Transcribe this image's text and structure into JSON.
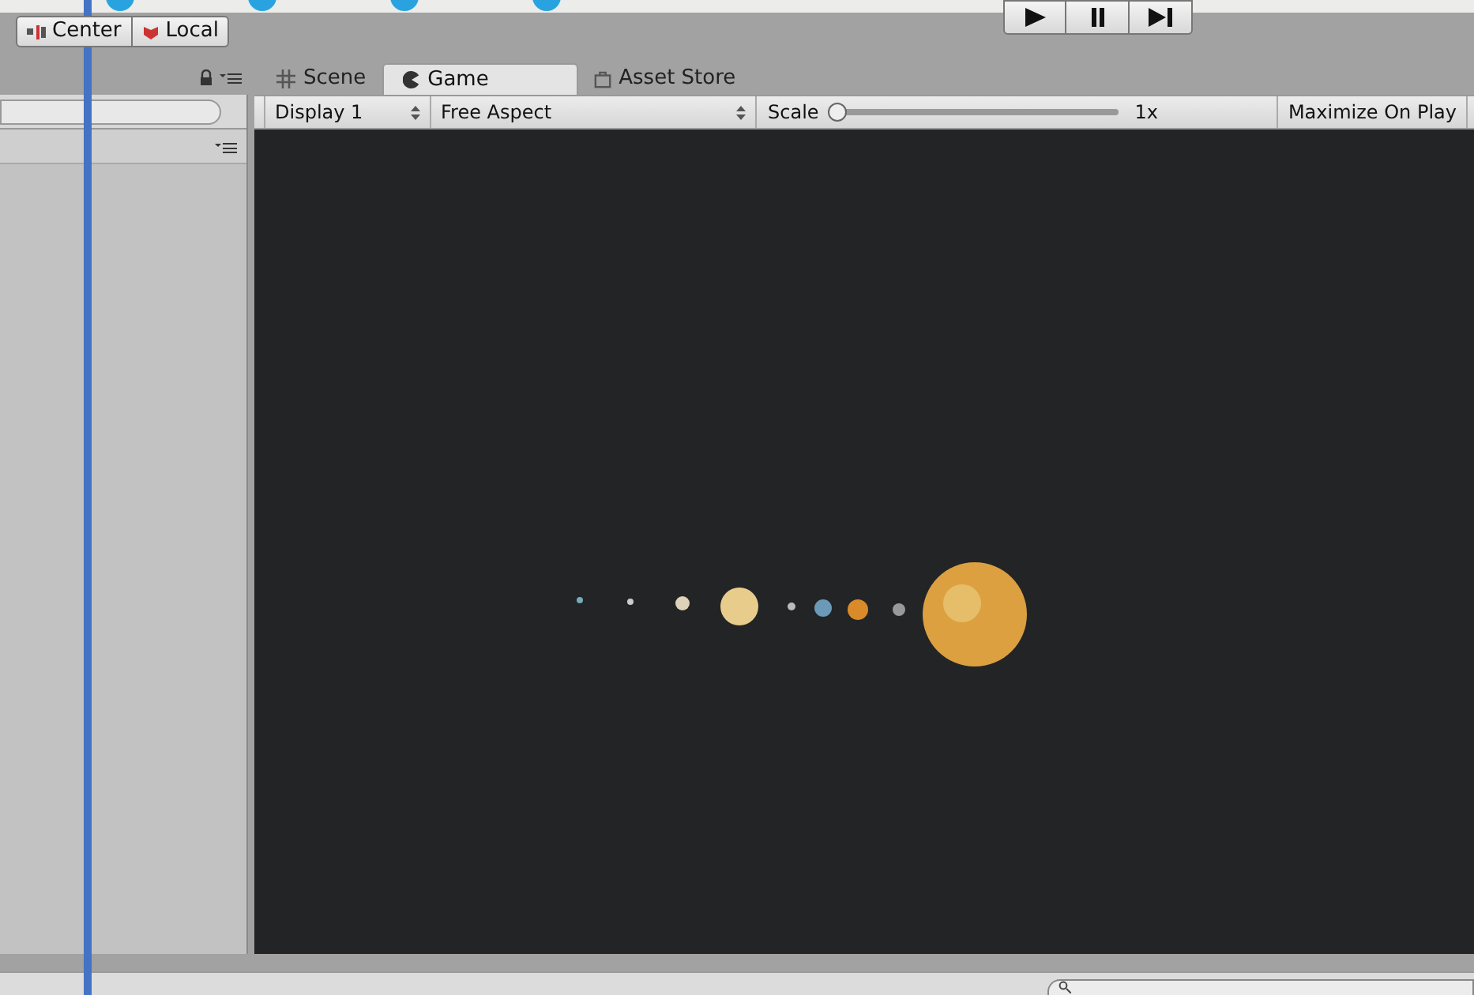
{
  "pivot_buttons": [
    {
      "label": "Center",
      "kind": "center"
    },
    {
      "label": "Local",
      "kind": "local"
    }
  ],
  "play_controls": [
    {
      "kind": "play",
      "selected": false
    },
    {
      "kind": "pause",
      "selected": false
    },
    {
      "kind": "step",
      "selected": false
    }
  ],
  "tabs": [
    {
      "label": "Scene",
      "kind": "scene",
      "selected": false
    },
    {
      "label": "Game",
      "kind": "game",
      "selected": true
    },
    {
      "label": "Asset Store",
      "kind": "store",
      "selected": false
    }
  ],
  "game_toolbar": {
    "display": "Display 1",
    "aspect": "Free Aspect",
    "scale_label": "Scale",
    "scale": {
      "level": 0,
      "reading": "1x"
    },
    "maximize": {
      "label": "Maximize On Play",
      "selected": false
    }
  }
}
